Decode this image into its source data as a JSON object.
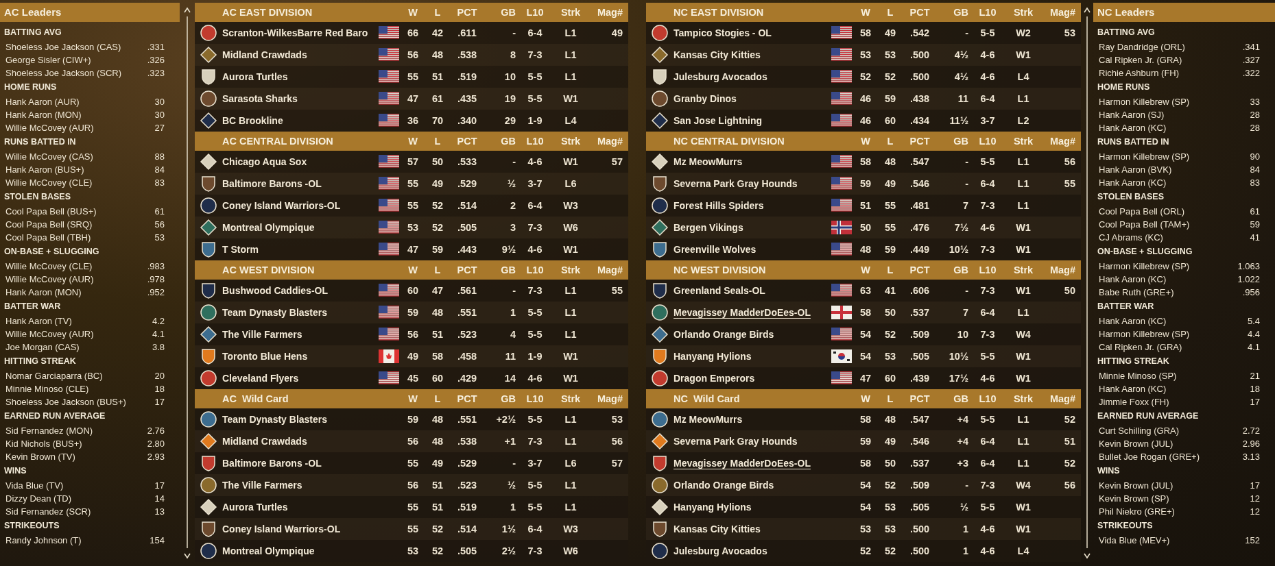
{
  "ac_leaders": {
    "title": "AC Leaders",
    "categories": [
      {
        "title": "BATTING AVG",
        "rows": [
          {
            "name": "Shoeless Joe Jackson (CAS)",
            "value": ".331"
          },
          {
            "name": "George Sisler (CIW+)",
            "value": ".326"
          },
          {
            "name": "Shoeless Joe Jackson (SCR)",
            "value": ".323"
          }
        ]
      },
      {
        "title": "HOME RUNS",
        "rows": [
          {
            "name": "Hank Aaron (AUR)",
            "value": "30"
          },
          {
            "name": "Hank Aaron (MON)",
            "value": "30"
          },
          {
            "name": "Willie McCovey (AUR)",
            "value": "27"
          }
        ]
      },
      {
        "title": "RUNS BATTED IN",
        "rows": [
          {
            "name": "Willie McCovey (CAS)",
            "value": "88"
          },
          {
            "name": "Hank Aaron (BUS+)",
            "value": "84"
          },
          {
            "name": "Willie McCovey (CLE)",
            "value": "83"
          }
        ]
      },
      {
        "title": "STOLEN BASES",
        "rows": [
          {
            "name": "Cool Papa Bell (BUS+)",
            "value": "61"
          },
          {
            "name": "Cool Papa Bell (SRQ)",
            "value": "56"
          },
          {
            "name": "Cool Papa Bell (TBH)",
            "value": "53"
          }
        ]
      },
      {
        "title": "ON-BASE + SLUGGING",
        "rows": [
          {
            "name": "Willie McCovey (CLE)",
            "value": ".983"
          },
          {
            "name": "Willie McCovey (AUR)",
            "value": ".978"
          },
          {
            "name": "Hank Aaron (MON)",
            "value": ".952"
          }
        ]
      },
      {
        "title": "BATTER WAR",
        "rows": [
          {
            "name": "Hank Aaron (TV)",
            "value": "4.2"
          },
          {
            "name": "Willie McCovey (AUR)",
            "value": "4.1"
          },
          {
            "name": "Joe Morgan (CAS)",
            "value": "3.8"
          }
        ]
      },
      {
        "title": "HITTING STREAK",
        "rows": [
          {
            "name": "Nomar Garciaparra (BC)",
            "value": "20"
          },
          {
            "name": "Minnie Minoso (CLE)",
            "value": "18"
          },
          {
            "name": "Shoeless Joe Jackson (BUS+)",
            "value": "17"
          }
        ]
      },
      {
        "title": "EARNED RUN AVERAGE",
        "rows": [
          {
            "name": "Sid Fernandez (MON)",
            "value": "2.76"
          },
          {
            "name": "Kid Nichols (BUS+)",
            "value": "2.80"
          },
          {
            "name": "Kevin Brown (TV)",
            "value": "2.93"
          }
        ]
      },
      {
        "title": "WINS",
        "rows": [
          {
            "name": "Vida Blue (TV)",
            "value": "17"
          },
          {
            "name": "Dizzy Dean (TD)",
            "value": "14"
          },
          {
            "name": "Sid Fernandez (SCR)",
            "value": "13"
          }
        ]
      },
      {
        "title": "STRIKEOUTS",
        "rows": [
          {
            "name": "Randy Johnson (T)",
            "value": "154"
          }
        ]
      }
    ]
  },
  "ac_standings": [
    {
      "title": "AC EAST DIVISION",
      "columns": [
        "W",
        "L",
        "PCT",
        "GB",
        "L10",
        "Strk",
        "Mag#"
      ],
      "rows": [
        {
          "team": "Scranton-WilkesBarre Red Baro",
          "flag": {
            "kind": "us"
          },
          "w": "66",
          "l": "42",
          "pct": ".611",
          "gb": "-",
          "l10": "6-4",
          "strk": "L1",
          "mag": "49",
          "user_team": false
        },
        {
          "team": "Midland Crawdads",
          "flag": {
            "kind": "us"
          },
          "w": "56",
          "l": "48",
          "pct": ".538",
          "gb": "8",
          "l10": "7-3",
          "strk": "L1",
          "user_team": false
        },
        {
          "team": "Aurora Turtles",
          "flag": {
            "kind": "us"
          },
          "w": "55",
          "l": "51",
          "pct": ".519",
          "gb": "10",
          "l10": "5-5",
          "strk": "L1",
          "user_team": false
        },
        {
          "team": "Sarasota Sharks",
          "flag": {
            "kind": "us"
          },
          "w": "47",
          "l": "61",
          "pct": ".435",
          "gb": "19",
          "l10": "5-5",
          "strk": "W1",
          "user_team": false
        },
        {
          "team": "BC Brookline",
          "flag": {
            "kind": "us"
          },
          "w": "36",
          "l": "70",
          "pct": ".340",
          "gb": "29",
          "l10": "1-9",
          "strk": "L4",
          "user_team": false
        }
      ]
    },
    {
      "title": "AC CENTRAL DIVISION",
      "columns": [
        "W",
        "L",
        "PCT",
        "GB",
        "L10",
        "Strk",
        "Mag#"
      ],
      "rows": [
        {
          "team": "Chicago Aqua Sox",
          "flag": {
            "kind": "us"
          },
          "w": "57",
          "l": "50",
          "pct": ".533",
          "gb": "-",
          "l10": "4-6",
          "strk": "W1",
          "mag": "57",
          "user_team": false
        },
        {
          "team": "Baltimore Barons -OL",
          "flag": {
            "kind": "us"
          },
          "w": "55",
          "l": "49",
          "pct": ".529",
          "gb": "½",
          "l10": "3-7",
          "strk": "L6",
          "user_team": false
        },
        {
          "team": "Coney Island Warriors-OL",
          "flag": {
            "kind": "us"
          },
          "w": "55",
          "l": "52",
          "pct": ".514",
          "gb": "2",
          "l10": "6-4",
          "strk": "W3",
          "user_team": false
        },
        {
          "team": "Montreal Olympique",
          "flag": {
            "kind": "us"
          },
          "w": "53",
          "l": "52",
          "pct": ".505",
          "gb": "3",
          "l10": "7-3",
          "strk": "W6",
          "user_team": false
        },
        {
          "team": "T Storm",
          "flag": {
            "kind": "us"
          },
          "w": "47",
          "l": "59",
          "pct": ".443",
          "gb": "9½",
          "l10": "4-6",
          "strk": "W1",
          "user_team": false
        }
      ]
    },
    {
      "title": "AC WEST DIVISION",
      "columns": [
        "W",
        "L",
        "PCT",
        "GB",
        "L10",
        "Strk",
        "Mag#"
      ],
      "rows": [
        {
          "team": "Bushwood Caddies-OL",
          "flag": {
            "kind": "us"
          },
          "w": "60",
          "l": "47",
          "pct": ".561",
          "gb": "-",
          "l10": "7-3",
          "strk": "L1",
          "mag": "55",
          "user_team": false
        },
        {
          "team": "Team Dynasty Blasters",
          "flag": {
            "kind": "us"
          },
          "w": "59",
          "l": "48",
          "pct": ".551",
          "gb": "1",
          "l10": "5-5",
          "strk": "L1",
          "user_team": false
        },
        {
          "team": "The Ville Farmers",
          "flag": {
            "kind": "us"
          },
          "w": "56",
          "l": "51",
          "pct": ".523",
          "gb": "4",
          "l10": "5-5",
          "strk": "L1",
          "user_team": false
        },
        {
          "team": "Toronto Blue Hens",
          "flag": {
            "kind": "ca"
          },
          "w": "49",
          "l": "58",
          "pct": ".458",
          "gb": "11",
          "l10": "1-9",
          "strk": "W1",
          "user_team": false
        },
        {
          "team": "Cleveland Flyers",
          "flag": {
            "kind": "us"
          },
          "w": "45",
          "l": "60",
          "pct": ".429",
          "gb": "14",
          "l10": "4-6",
          "strk": "W1",
          "user_team": false
        }
      ]
    },
    {
      "title": "AC  Wild Card",
      "columns": [
        "W",
        "L",
        "PCT",
        "GB",
        "L10",
        "Strk",
        "Mag#"
      ],
      "rows": [
        {
          "team": "Team Dynasty Blasters",
          "w": "59",
          "l": "48",
          "pct": ".551",
          "gb": "+2½",
          "l10": "5-5",
          "strk": "L1",
          "mag": "53",
          "user_team": false
        },
        {
          "team": "Midland Crawdads",
          "w": "56",
          "l": "48",
          "pct": ".538",
          "gb": "+1",
          "l10": "7-3",
          "strk": "L1",
          "mag": "56",
          "user_team": false
        },
        {
          "team": "Baltimore Barons -OL",
          "w": "55",
          "l": "49",
          "pct": ".529",
          "gb": "-",
          "l10": "3-7",
          "strk": "L6",
          "mag": "57",
          "user_team": false
        },
        {
          "team": "The Ville Farmers",
          "w": "56",
          "l": "51",
          "pct": ".523",
          "gb": "½",
          "l10": "5-5",
          "strk": "L1",
          "user_team": false
        },
        {
          "team": "Aurora Turtles",
          "w": "55",
          "l": "51",
          "pct": ".519",
          "gb": "1",
          "l10": "5-5",
          "strk": "L1",
          "user_team": false
        },
        {
          "team": "Coney Island Warriors-OL",
          "w": "55",
          "l": "52",
          "pct": ".514",
          "gb": "1½",
          "l10": "6-4",
          "strk": "W3",
          "user_team": false
        },
        {
          "team": "Montreal Olympique",
          "w": "53",
          "l": "52",
          "pct": ".505",
          "gb": "2½",
          "l10": "7-3",
          "strk": "W6",
          "user_team": false
        }
      ]
    }
  ],
  "nc_standings": [
    {
      "title": "NC EAST DIVISION",
      "columns": [
        "W",
        "L",
        "PCT",
        "GB",
        "L10",
        "Strk",
        "Mag#"
      ],
      "rows": [
        {
          "team": "Tampico Stogies - OL",
          "flag": {
            "kind": "us"
          },
          "w": "58",
          "l": "49",
          "pct": ".542",
          "gb": "-",
          "l10": "5-5",
          "strk": "W2",
          "mag": "53",
          "user_team": false
        },
        {
          "team": "Kansas City Kitties",
          "flag": {
            "kind": "us"
          },
          "w": "53",
          "l": "53",
          "pct": ".500",
          "gb": "4½",
          "l10": "4-6",
          "strk": "W1",
          "user_team": false
        },
        {
          "team": "Julesburg Avocados",
          "flag": {
            "kind": "us"
          },
          "w": "52",
          "l": "52",
          "pct": ".500",
          "gb": "4½",
          "l10": "4-6",
          "strk": "L4",
          "user_team": false
        },
        {
          "team": "Granby Dinos",
          "flag": {
            "kind": "us"
          },
          "w": "46",
          "l": "59",
          "pct": ".438",
          "gb": "11",
          "l10": "6-4",
          "strk": "L1",
          "user_team": false
        },
        {
          "team": "San Jose Lightning",
          "flag": {
            "kind": "us"
          },
          "w": "46",
          "l": "60",
          "pct": ".434",
          "gb": "11½",
          "l10": "3-7",
          "strk": "L2",
          "user_team": false
        }
      ]
    },
    {
      "title": "NC CENTRAL DIVISION",
      "columns": [
        "W",
        "L",
        "PCT",
        "GB",
        "L10",
        "Strk",
        "Mag#"
      ],
      "rows": [
        {
          "team": "Mz MeowMurrs",
          "flag": {
            "kind": "us"
          },
          "w": "58",
          "l": "48",
          "pct": ".547",
          "gb": "-",
          "l10": "5-5",
          "strk": "L1",
          "mag": "56",
          "user_team": false
        },
        {
          "team": "Severna Park Gray Hounds",
          "flag": {
            "kind": "us"
          },
          "w": "59",
          "l": "49",
          "pct": ".546",
          "gb": "-",
          "l10": "6-4",
          "strk": "L1",
          "mag": "55",
          "user_team": false
        },
        {
          "team": "Forest Hills Spiders",
          "flag": {
            "kind": "us"
          },
          "w": "51",
          "l": "55",
          "pct": ".481",
          "gb": "7",
          "l10": "7-3",
          "strk": "L1",
          "user_team": false
        },
        {
          "team": "Bergen Vikings",
          "flag": {
            "kind": "no"
          },
          "w": "50",
          "l": "55",
          "pct": ".476",
          "gb": "7½",
          "l10": "4-6",
          "strk": "W1",
          "user_team": false
        },
        {
          "team": "Greenville Wolves",
          "flag": {
            "kind": "us"
          },
          "w": "48",
          "l": "59",
          "pct": ".449",
          "gb": "10½",
          "l10": "7-3",
          "strk": "W1",
          "user_team": false
        }
      ]
    },
    {
      "title": "NC WEST DIVISION",
      "columns": [
        "W",
        "L",
        "PCT",
        "GB",
        "L10",
        "Strk",
        "Mag#"
      ],
      "rows": [
        {
          "team": "Greenland Seals-OL",
          "flag": {
            "kind": "us"
          },
          "w": "63",
          "l": "41",
          "pct": ".606",
          "gb": "-",
          "l10": "7-3",
          "strk": "W1",
          "mag": "50",
          "user_team": false
        },
        {
          "team": "Mevagissey MadderDoEes-OL",
          "flag": {
            "kind": "england"
          },
          "w": "58",
          "l": "50",
          "pct": ".537",
          "gb": "7",
          "l10": "6-4",
          "strk": "L1",
          "user_team": true
        },
        {
          "team": "Orlando Orange Birds",
          "flag": {
            "kind": "us"
          },
          "w": "54",
          "l": "52",
          "pct": ".509",
          "gb": "10",
          "l10": "7-3",
          "strk": "W4",
          "user_team": false
        },
        {
          "team": "Hanyang Hylions",
          "flag": {
            "kind": "kr"
          },
          "w": "54",
          "l": "53",
          "pct": ".505",
          "gb": "10½",
          "l10": "5-5",
          "strk": "W1",
          "user_team": false
        },
        {
          "team": "Dragon Emperors",
          "flag": {
            "kind": "us"
          },
          "w": "47",
          "l": "60",
          "pct": ".439",
          "gb": "17½",
          "l10": "4-6",
          "strk": "W1",
          "user_team": false
        }
      ]
    },
    {
      "title": "NC  Wild Card",
      "columns": [
        "W",
        "L",
        "PCT",
        "GB",
        "L10",
        "Strk",
        "Mag#"
      ],
      "rows": [
        {
          "team": "Mz MeowMurrs",
          "w": "58",
          "l": "48",
          "pct": ".547",
          "gb": "+4",
          "l10": "5-5",
          "strk": "L1",
          "mag": "52",
          "user_team": false
        },
        {
          "team": "Severna Park Gray Hounds",
          "w": "59",
          "l": "49",
          "pct": ".546",
          "gb": "+4",
          "l10": "6-4",
          "strk": "L1",
          "mag": "51",
          "user_team": false
        },
        {
          "team": "Mevagissey MadderDoEes-OL",
          "w": "58",
          "l": "50",
          "pct": ".537",
          "gb": "+3",
          "l10": "6-4",
          "strk": "L1",
          "mag": "52",
          "user_team": true
        },
        {
          "team": "Orlando Orange Birds",
          "w": "54",
          "l": "52",
          "pct": ".509",
          "gb": "-",
          "l10": "7-3",
          "strk": "W4",
          "mag": "56",
          "user_team": false
        },
        {
          "team": "Hanyang Hylions",
          "w": "54",
          "l": "53",
          "pct": ".505",
          "gb": "½",
          "l10": "5-5",
          "strk": "W1",
          "user_team": false
        },
        {
          "team": "Kansas City Kitties",
          "w": "53",
          "l": "53",
          "pct": ".500",
          "gb": "1",
          "l10": "4-6",
          "strk": "W1",
          "user_team": false
        },
        {
          "team": "Julesburg Avocados",
          "w": "52",
          "l": "52",
          "pct": ".500",
          "gb": "1",
          "l10": "4-6",
          "strk": "L4",
          "user_team": false
        }
      ]
    }
  ],
  "nc_leaders": {
    "title": "NC Leaders",
    "categories": [
      {
        "title": "BATTING AVG",
        "rows": [
          {
            "name": "Ray Dandridge (ORL)",
            "value": ".341"
          },
          {
            "name": "Cal Ripken Jr. (GRA)",
            "value": ".327"
          },
          {
            "name": "Richie Ashburn (FH)",
            "value": ".322"
          }
        ]
      },
      {
        "title": "HOME RUNS",
        "rows": [
          {
            "name": "Harmon Killebrew (SP)",
            "value": "33"
          },
          {
            "name": "Hank Aaron (SJ)",
            "value": "28"
          },
          {
            "name": "Hank Aaron (KC)",
            "value": "28"
          }
        ]
      },
      {
        "title": "RUNS BATTED IN",
        "rows": [
          {
            "name": "Harmon Killebrew (SP)",
            "value": "90"
          },
          {
            "name": "Hank Aaron (BVK)",
            "value": "84"
          },
          {
            "name": "Hank Aaron (KC)",
            "value": "83"
          }
        ]
      },
      {
        "title": "STOLEN BASES",
        "rows": [
          {
            "name": "Cool Papa Bell (ORL)",
            "value": "61"
          },
          {
            "name": "Cool Papa Bell (TAM+)",
            "value": "59"
          },
          {
            "name": "CJ Abrams (KC)",
            "value": "41"
          }
        ]
      },
      {
        "title": "ON-BASE + SLUGGING",
        "rows": [
          {
            "name": "Harmon Killebrew (SP)",
            "value": "1.063"
          },
          {
            "name": "Hank Aaron (KC)",
            "value": "1.022"
          },
          {
            "name": "Babe Ruth (GRE+)",
            "value": ".956"
          }
        ]
      },
      {
        "title": "BATTER WAR",
        "rows": [
          {
            "name": "Hank Aaron (KC)",
            "value": "5.4"
          },
          {
            "name": "Harmon Killebrew (SP)",
            "value": "4.4"
          },
          {
            "name": "Cal Ripken Jr. (GRA)",
            "value": "4.1"
          }
        ]
      },
      {
        "title": "HITTING STREAK",
        "rows": [
          {
            "name": "Minnie Minoso (SP)",
            "value": "21"
          },
          {
            "name": "Hank Aaron (KC)",
            "value": "18"
          },
          {
            "name": "Jimmie Foxx (FH)",
            "value": "17"
          }
        ]
      },
      {
        "title": "EARNED RUN AVERAGE",
        "rows": [
          {
            "name": "Curt Schilling (GRA)",
            "value": "2.72"
          },
          {
            "name": "Kevin Brown (JUL)",
            "value": "2.96"
          },
          {
            "name": "Bullet Joe Rogan (GRE+)",
            "value": "3.13"
          }
        ]
      },
      {
        "title": "WINS",
        "rows": [
          {
            "name": "Kevin Brown (JUL)",
            "value": "17"
          },
          {
            "name": "Kevin Brown (SP)",
            "value": "12"
          },
          {
            "name": "Phil Niekro (GRE+)",
            "value": "12"
          }
        ]
      },
      {
        "title": "STRIKEOUTS",
        "rows": [
          {
            "name": "Vida Blue (MEV+)",
            "value": "152"
          }
        ]
      }
    ]
  }
}
